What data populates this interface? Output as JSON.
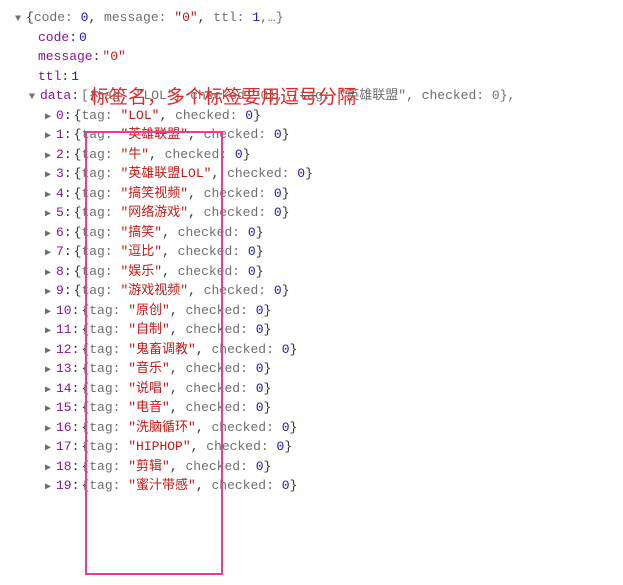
{
  "annotation": "标签名，多个标签要用逗号分隔",
  "root": {
    "summary_prefix": "{",
    "summary_parts": [
      {
        "k": "code",
        "v": "0",
        "t": "num"
      },
      {
        "k": "message",
        "v": "\"0\"",
        "t": "str"
      },
      {
        "k": "ttl",
        "v": "1",
        "t": "num"
      }
    ],
    "summary_suffix": ",…}",
    "code_key": "code",
    "code_val": "0",
    "message_key": "message",
    "message_val": "\"0\"",
    "ttl_key": "ttl",
    "ttl_val": "1",
    "data_key": "data",
    "data_summary": "[{tag: \"LOL\", checked: 0}, {tag: \"英雄联盟\", checked: 0},",
    "items": [
      {
        "idx": "0",
        "tag": "\"LOL\"",
        "checked": "0"
      },
      {
        "idx": "1",
        "tag": "\"英雄联盟\"",
        "checked": "0"
      },
      {
        "idx": "2",
        "tag": "\"牛\"",
        "checked": "0"
      },
      {
        "idx": "3",
        "tag": "\"英雄联盟LOL\"",
        "checked": "0"
      },
      {
        "idx": "4",
        "tag": "\"搞笑视频\"",
        "checked": "0"
      },
      {
        "idx": "5",
        "tag": "\"网络游戏\"",
        "checked": "0"
      },
      {
        "idx": "6",
        "tag": "\"搞笑\"",
        "checked": "0"
      },
      {
        "idx": "7",
        "tag": "\"逗比\"",
        "checked": "0"
      },
      {
        "idx": "8",
        "tag": "\"娱乐\"",
        "checked": "0"
      },
      {
        "idx": "9",
        "tag": "\"游戏视频\"",
        "checked": "0"
      },
      {
        "idx": "10",
        "tag": "\"原创\"",
        "checked": "0"
      },
      {
        "idx": "11",
        "tag": "\"自制\"",
        "checked": "0"
      },
      {
        "idx": "12",
        "tag": "\"鬼畜调教\"",
        "checked": "0"
      },
      {
        "idx": "13",
        "tag": "\"音乐\"",
        "checked": "0"
      },
      {
        "idx": "14",
        "tag": "\"说唱\"",
        "checked": "0"
      },
      {
        "idx": "15",
        "tag": "\"电音\"",
        "checked": "0"
      },
      {
        "idx": "16",
        "tag": "\"洗脑循环\"",
        "checked": "0"
      },
      {
        "idx": "17",
        "tag": "\"HIPHOP\"",
        "checked": "0"
      },
      {
        "idx": "18",
        "tag": "\"剪辑\"",
        "checked": "0"
      },
      {
        "idx": "19",
        "tag": "\"蜜汁带感\"",
        "checked": "0"
      }
    ],
    "tag_key": "tag",
    "checked_key": "checked"
  },
  "glyphs": {
    "expanded": "▼",
    "collapsed": "▶"
  }
}
